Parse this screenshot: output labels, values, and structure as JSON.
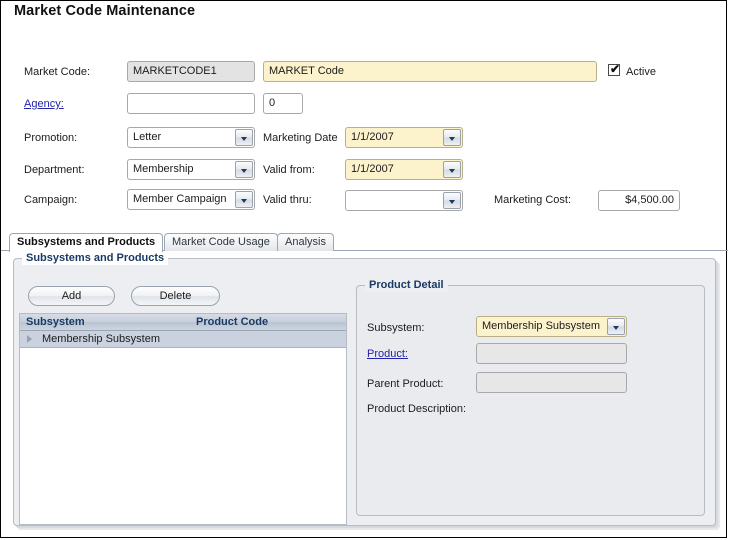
{
  "page": {
    "title": "Market Code Maintenance"
  },
  "form": {
    "market_code_label": "Market Code:",
    "market_code_value": "MARKETCODE1",
    "market_code_desc_value": "MARKET Code",
    "active_label": "Active",
    "active_checked": true,
    "agency_label": "Agency:",
    "agency_value": "",
    "agency_placeholder": "",
    "agency_id_value": "0",
    "promotion_label": "Promotion:",
    "promotion_value": "Letter",
    "department_label": "Department:",
    "department_value": "Membership",
    "campaign_label": "Campaign:",
    "campaign_value": "Member Campaign",
    "marketing_date_label": "Marketing Date",
    "marketing_date_value": "1/1/2007",
    "valid_from_label": "Valid from:",
    "valid_from_value": "1/1/2007",
    "valid_thru_label": "Valid thru:",
    "valid_thru_value": "",
    "marketing_cost_label": "Marketing Cost:",
    "marketing_cost_value": "$4,500.00"
  },
  "tabs": [
    {
      "label": "Subsystems and Products",
      "active": true
    },
    {
      "label": "Market Code Usage",
      "active": false
    },
    {
      "label": "Analysis",
      "active": false
    }
  ],
  "subsystems_panel": {
    "title": "Subsystems and Products",
    "add_label": "Add",
    "delete_label": "Delete",
    "grid": {
      "columns": [
        "Subsystem",
        "Product Code"
      ],
      "rows": [
        {
          "subsystem": "Membership Subsystem",
          "product_code": "",
          "selected": true,
          "expandable": true
        }
      ]
    }
  },
  "product_detail": {
    "title": "Product Detail",
    "subsystem_label": "Subsystem:",
    "subsystem_value": "Membership Subsystem",
    "product_label": "Product:",
    "product_value": "",
    "parent_product_label": "Parent Product:",
    "parent_product_value": "",
    "product_description_label": "Product Description:",
    "product_description_value": ""
  },
  "colors": {
    "required_field": "#fcf3cd",
    "readonly_field": "#e3e3e3",
    "link": "#2222aa",
    "group_title": "#1b3a63",
    "grid_selection": "#c9d2de"
  }
}
